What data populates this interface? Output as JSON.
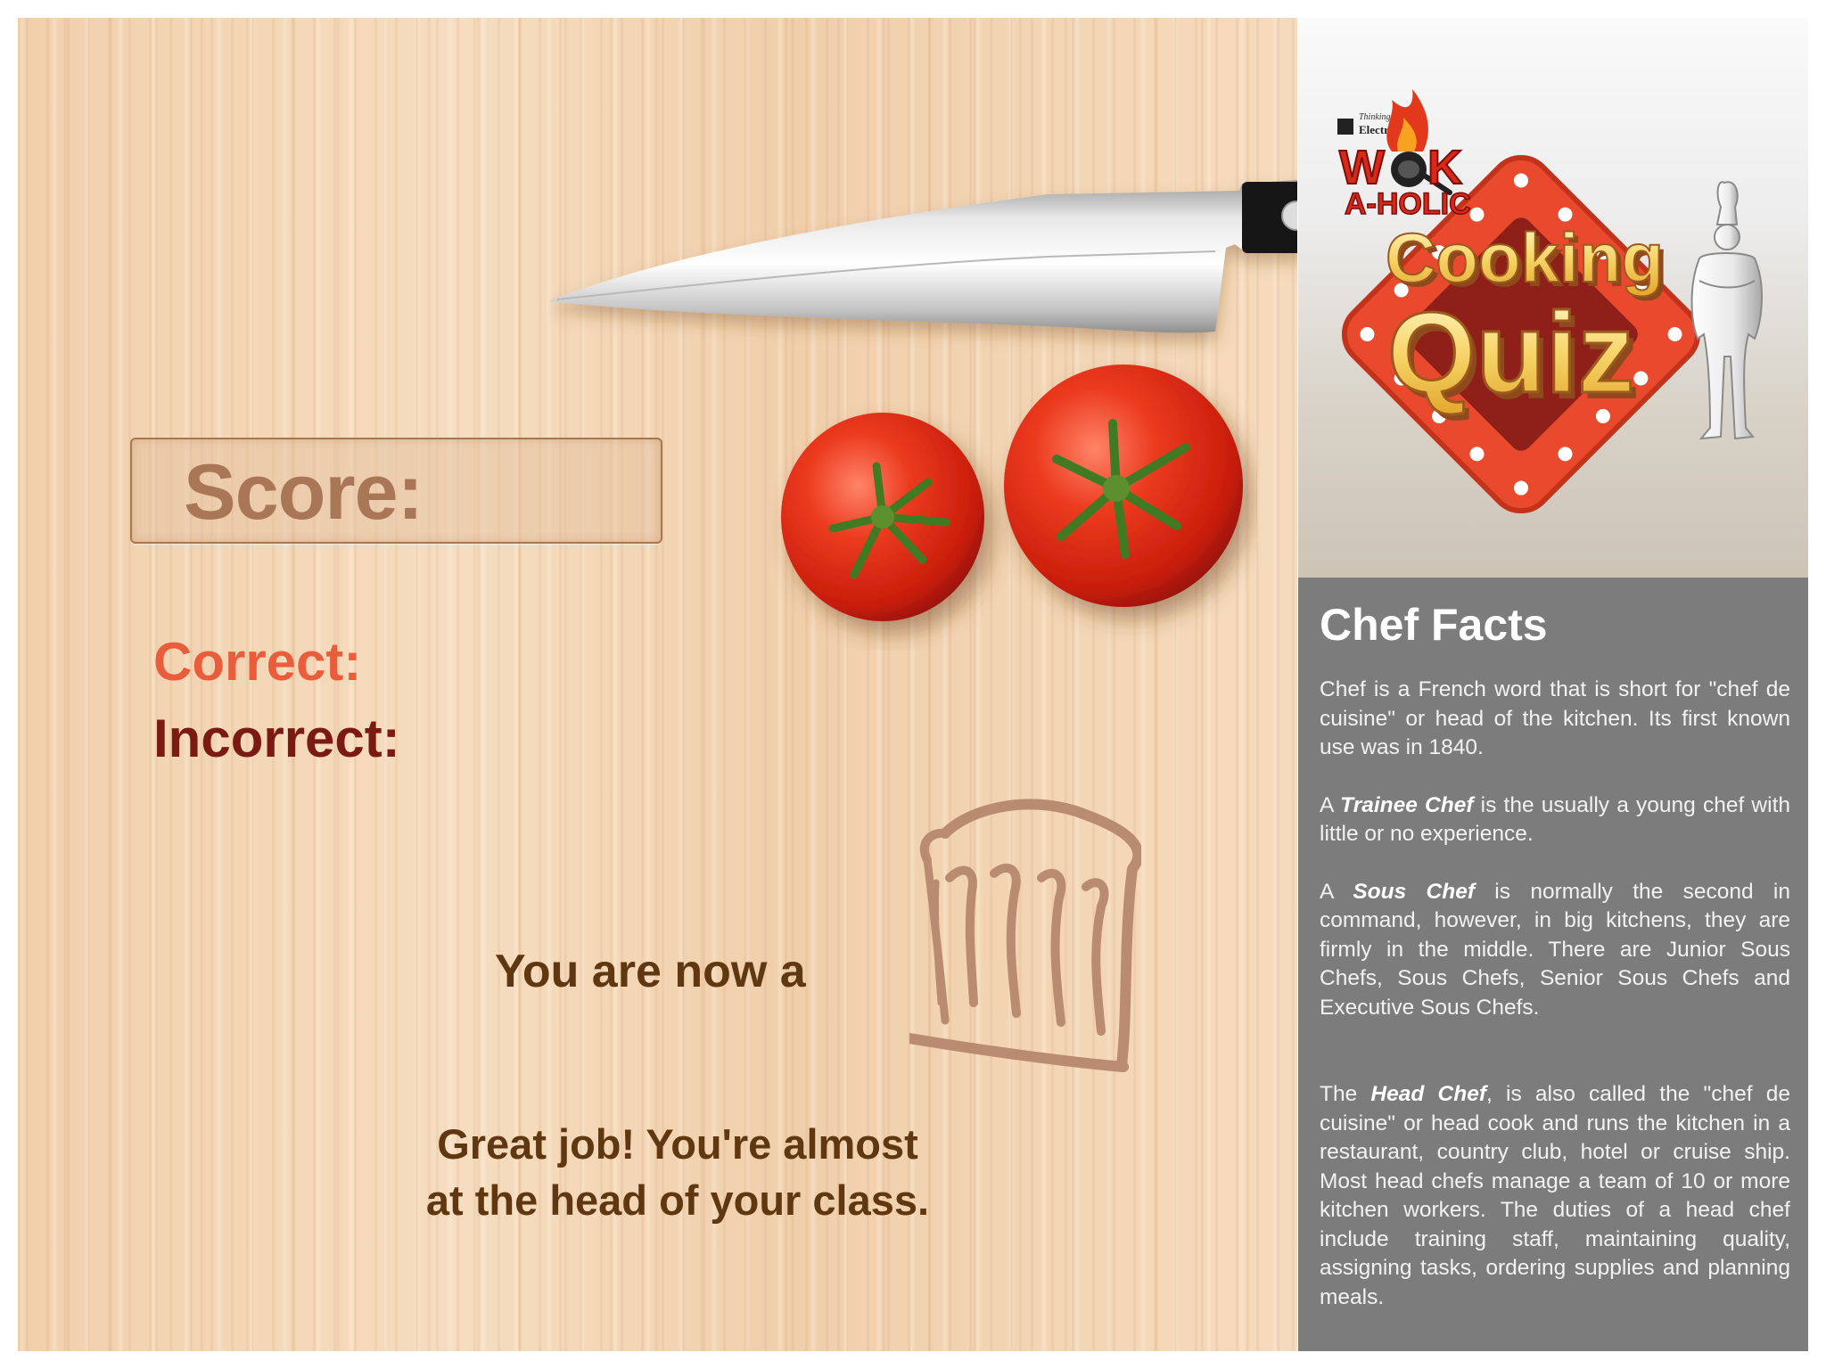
{
  "score": {
    "label": "Score:"
  },
  "stats": {
    "correct_label": "Correct:",
    "incorrect_label": "Incorrect:"
  },
  "result": {
    "rank_prefix": "You are now a",
    "message_line1": "Great job! You're almost",
    "message_line2": "at the head of your class."
  },
  "logo": {
    "brand_tagline": "Thinking of you",
    "brand_name": "Electrolux",
    "wok_text": "W",
    "wok_text2": "K",
    "aholic_text": "A-HOLIC",
    "title_line1": "Cooking",
    "title_line2": "Quiz"
  },
  "facts": {
    "title": "Chef Facts",
    "items": [
      {
        "pre": "Chef is a French word that is short for \"chef de cuisine\" or head of the kitchen. Its first known use was in 1840.",
        "term": "",
        "post": ""
      },
      {
        "pre": "A ",
        "term": "Trainee Chef",
        "post": " is the usually a young chef with little or no experience."
      },
      {
        "pre": "A ",
        "term": "Sous Chef",
        "post": " is normally the second in command, however, in big kitchens, they are firmly in the middle. There are Junior Sous Chefs, Sous Chefs, Senior Sous Chefs and Executive Sous Chefs."
      },
      {
        "pre": "The ",
        "term": "Head Chef",
        "post": ", is also called the \"chef de cuisine\" or head cook and runs the kitchen in a restaurant, country club, hotel or cruise ship. Most head chefs manage a team of 10 or more kitchen workers. The duties of a head chef include training staff, maintaining quality, assigning tasks, ordering supplies and planning meals."
      }
    ]
  },
  "colors": {
    "correct": "#ea5d3c",
    "incorrect": "#7a1a12",
    "text_brown": "#5f3711",
    "facts_bg": "#7c7c7c"
  },
  "icons": [
    "knife-image",
    "tomato-image",
    "chef-hat-icon",
    "chef-figure-icon",
    "flame-icon",
    "wok-icon"
  ]
}
